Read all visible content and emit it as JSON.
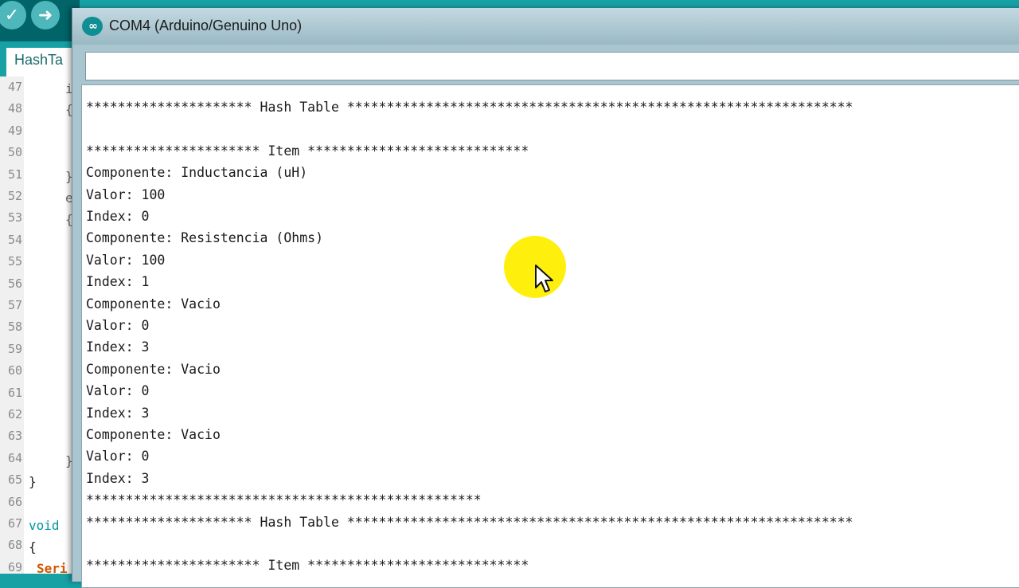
{
  "ide": {
    "toolbar": {
      "verify_icon": "check-icon",
      "upload_icon": "arrow-right-icon"
    },
    "tab_label": "HashTa",
    "gutter": {
      "line_numbers": [
        "47",
        "48",
        "49",
        "50",
        "51",
        "52",
        "53",
        "54",
        "55",
        "56",
        "57",
        "58",
        "59",
        "60",
        "61",
        "62",
        "63",
        "64",
        "65",
        "66",
        "67",
        "68",
        "69"
      ]
    },
    "code": {
      "line65": "}",
      "line67_kw": "void",
      "line68": "{",
      "line69_fn": "Seri"
    }
  },
  "serial_monitor": {
    "title": "COM4 (Arduino/Genuino Uno)",
    "send_input_value": "",
    "output_lines": [
      "********************* Hash Table ****************************************************************",
      "",
      "********************** Item ****************************",
      "Componente: Inductancia (uH)",
      "Valor: 100",
      "Index: 0",
      "Componente: Resistencia (Ohms)",
      "Valor: 100",
      "Index: 1",
      "Componente: Vacio",
      "Valor: 0",
      "Index: 3",
      "Componente: Vacio",
      "Valor: 0",
      "Index: 3",
      "Componente: Vacio",
      "Valor: 0",
      "Index: 3",
      "**************************************************",
      "********************* Hash Table ****************************************************************",
      "",
      "********************** Item ****************************"
    ]
  },
  "colors": {
    "arduino_teal": "#00979c",
    "cursor_highlight": "#ffee00"
  }
}
